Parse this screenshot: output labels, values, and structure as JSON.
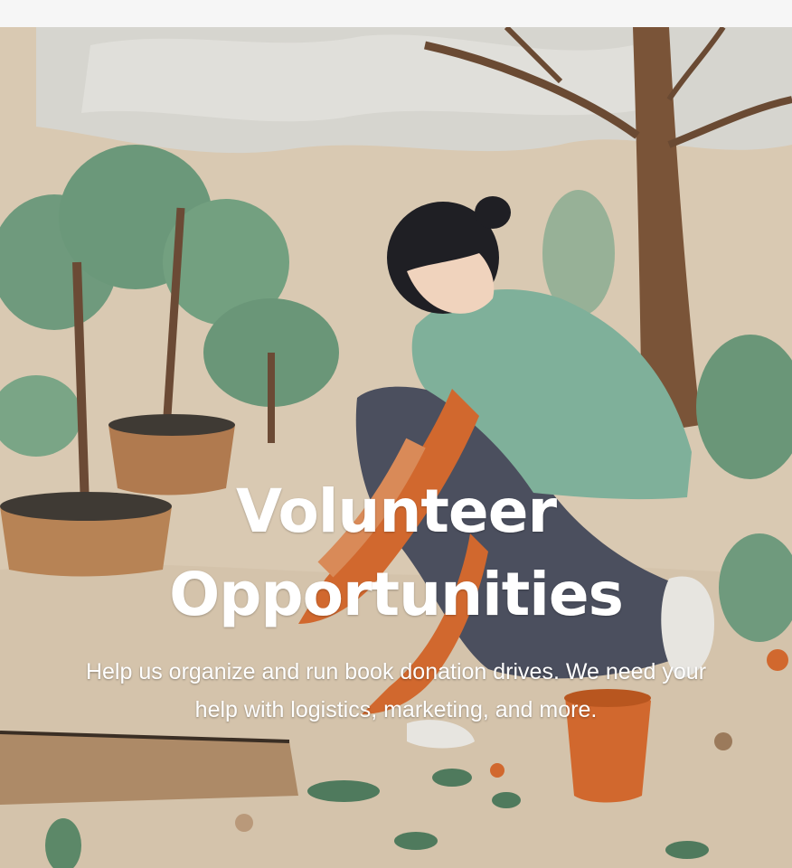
{
  "hero": {
    "title": "Volunteer Opportunities",
    "description": "Help us organize and run book donation drives. We need your help with logistics, marketing, and more.",
    "image": {
      "subject": "illustration",
      "colors": {
        "background": "#d9c9b2",
        "sky": "#d7d6d1",
        "foliage": "#6f9a7d",
        "trunk": "#7a5438",
        "shirt": "#7fb09a",
        "pants": "#4b4f5e",
        "glove": "#d1682e",
        "pot": "#b78355"
      }
    }
  }
}
